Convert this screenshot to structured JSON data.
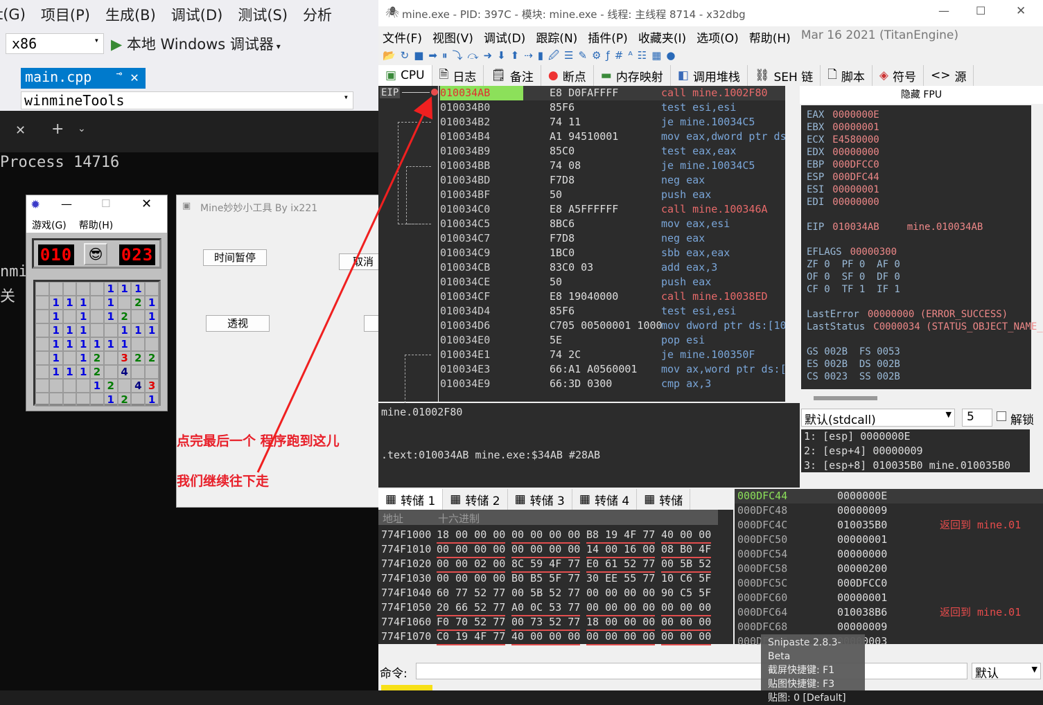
{
  "vs": {
    "menu": [
      "t(G)",
      "项目(P)",
      "生成(B)",
      "调试(D)",
      "测试(S)",
      "分析"
    ],
    "platform": "x86",
    "debugger_label": "本地 Windows 调试器",
    "tab_label": "main.cpp",
    "project_combo": "winmineTools"
  },
  "terminal": {
    "process_text": "Process 14716",
    "frag1": "nmi",
    "frag2": "关"
  },
  "minesweeper": {
    "menu": [
      "游戏(G)",
      "帮助(H)"
    ],
    "mine_counter": "010",
    "timer": "023",
    "grid": [
      [
        "",
        "",
        "",
        "",
        "",
        "1",
        "1",
        "1",
        ""
      ],
      [
        "",
        "1",
        "1",
        "1",
        "",
        "1",
        "",
        "2",
        "1"
      ],
      [
        "",
        "1",
        "",
        "1",
        "",
        "1",
        "2",
        "",
        "1"
      ],
      [
        "",
        "1",
        "1",
        "1",
        "",
        "",
        "1",
        "1",
        "1"
      ],
      [
        "",
        "1",
        "1",
        "1",
        "1",
        "1",
        "1",
        "",
        ""
      ],
      [
        "",
        "1",
        "",
        "1",
        "2",
        "",
        "3",
        "2",
        "2"
      ],
      [
        "",
        "1",
        "1",
        "1",
        "2",
        "",
        "4",
        "",
        ""
      ],
      [
        "",
        "",
        "",
        "",
        "1",
        "2",
        "",
        "4",
        "3"
      ],
      [
        "",
        "",
        "",
        "",
        "",
        "1",
        "2",
        "",
        "1"
      ]
    ]
  },
  "tool": {
    "title": "Mine妙妙小工具 By ix221",
    "btn_pause": "时间暂停",
    "btn_cancel": "取消",
    "btn_see": "透视",
    "note1": "点完最后一个  程序跑到这儿",
    "note2": "我们继续往下走"
  },
  "x32dbg": {
    "title": "mine.exe - PID: 397C - 模块: mine.exe - 线程: 主线程 8714 - x32dbg",
    "menu": [
      "文件(F)",
      "视图(V)",
      "调试(D)",
      "跟踪(N)",
      "插件(P)",
      "收藏夹(I)",
      "选项(O)",
      "帮助(H)",
      "Mar 16 2021 (TitanEngine)"
    ],
    "tabs": [
      "CPU",
      "日志",
      "备注",
      "断点",
      "内存映射",
      "调用堆栈",
      "SEH 链",
      "脚本",
      "符号",
      "源"
    ],
    "eip_label": "EIP",
    "disasm": [
      [
        "010034AB",
        "E8 D0FAFFFF",
        "call mine.1002F80",
        "call"
      ],
      [
        "010034B0",
        "85F6",
        "test esi,esi",
        ""
      ],
      [
        "010034B2",
        "74 11",
        "je mine.10034C5",
        ""
      ],
      [
        "010034B4",
        "A1 94510001",
        "mov eax,dword ptr ds:",
        ""
      ],
      [
        "010034B9",
        "85C0",
        "test eax,eax",
        ""
      ],
      [
        "010034BB",
        "74 08",
        "je mine.10034C5",
        ""
      ],
      [
        "010034BD",
        "F7D8",
        "neg eax",
        ""
      ],
      [
        "010034BF",
        "50",
        "push eax",
        ""
      ],
      [
        "010034C0",
        "E8 A5FFFFFF",
        "call mine.100346A",
        "call"
      ],
      [
        "010034C5",
        "8BC6",
        "mov eax,esi",
        ""
      ],
      [
        "010034C7",
        "F7D8",
        "neg eax",
        ""
      ],
      [
        "010034C9",
        "1BC0",
        "sbb eax,eax",
        ""
      ],
      [
        "010034CB",
        "83C0 03",
        "add eax,3",
        ""
      ],
      [
        "010034CE",
        "50",
        "push eax",
        ""
      ],
      [
        "010034CF",
        "E8 19040000",
        "call mine.10038ED",
        "call"
      ],
      [
        "010034D4",
        "85F6",
        "test esi,esi",
        ""
      ],
      [
        "010034D6",
        "C705 00500001 1000",
        "mov dword ptr ds:[10",
        ""
      ],
      [
        "010034E0",
        "5E",
        "pop esi",
        ""
      ],
      [
        "010034E1",
        "74 2C",
        "je mine.100350F",
        ""
      ],
      [
        "010034E3",
        "66:A1 A0560001",
        "mov ax,word ptr ds:[",
        ""
      ],
      [
        "010034E9",
        "66:3D 0300",
        "cmp ax,3",
        ""
      ]
    ],
    "regs_header": "隐藏 FPU",
    "regs": [
      [
        "EAX",
        "0000000E",
        ""
      ],
      [
        "EBX",
        "00000001",
        ""
      ],
      [
        "ECX",
        "E4580000",
        ""
      ],
      [
        "EDX",
        "00000000",
        ""
      ],
      [
        "EBP",
        "000DFCC0",
        ""
      ],
      [
        "ESP",
        "000DFC44",
        ""
      ],
      [
        "ESI",
        "00000001",
        ""
      ],
      [
        "EDI",
        "00000000",
        ""
      ],
      [
        "",
        "",
        " "
      ],
      [
        "EIP",
        "010034AB",
        "mine.010034AB"
      ],
      [
        "",
        "",
        ""
      ],
      [
        "EFLAGS",
        "00000300",
        ""
      ],
      [
        "ZF 0  PF 0  AF 0",
        "",
        ""
      ],
      [
        "OF 0  SF 0  DF 0",
        "",
        ""
      ],
      [
        "CF 0  TF 1  IF 1",
        "",
        ""
      ],
      [
        "",
        "",
        ""
      ],
      [
        "LastError",
        "00000000 (ERROR_SUCCESS)",
        ""
      ],
      [
        "LastStatus",
        "C0000034 (STATUS_OBJECT_NAME_",
        ""
      ],
      [
        "",
        "",
        ""
      ],
      [
        "GS 002B  FS 0053",
        "",
        ""
      ],
      [
        "ES 002B  DS 002B",
        "",
        ""
      ],
      [
        "CS 0023  SS 002B",
        "",
        ""
      ]
    ],
    "info_line1": "mine.01002F80",
    "info_line2": ".text:010034AB mine.exe:$34AB #28AB",
    "callconv": "默认(stdcall)",
    "argcount": "5",
    "unlock_label": "解锁",
    "args": [
      "1: [esp] 0000000E",
      "2: [esp+4] 00000009",
      "3: [esp+8] 010035B0 mine.010035B0"
    ],
    "dump_tabs": [
      "转储 1",
      "转储 2",
      "转储 3",
      "转储 4",
      "转储"
    ],
    "dump_headers": [
      "地址",
      "十六进制"
    ],
    "dump": [
      [
        "774F1000",
        "18 00 00 00",
        "00 00 00 00",
        "B8 19 4F 77",
        "40 00 00"
      ],
      [
        "774F1010",
        "00 00 00 00",
        "00 00 00 00",
        "14 00 16 00",
        "08 B0 4F"
      ],
      [
        "774F1020",
        "00 00 02 00",
        "8C 59 4F 77",
        "E0 61 52 77",
        "00 5B 52"
      ],
      [
        "774F1030",
        "00 00 00 00",
        "B0 B5 5F 77",
        "30 EE 55 77",
        "10 C6 5F"
      ],
      [
        "774F1040",
        "60 77 52 77",
        "00 5B 52 77",
        "00 00 00 00",
        "90 C5 5F"
      ],
      [
        "774F1050",
        "20 66 52 77",
        "A0 0C 53 77",
        "00 00 00 00",
        "00 00 00"
      ],
      [
        "774F1060",
        "F0 70 52 77",
        "00 73 52 77",
        "18 00 00 00",
        "00 00 00"
      ],
      [
        "774F1070",
        "C0 19 4F 77",
        "40 00 00 00",
        "00 00 00 00",
        "00 00 00"
      ]
    ],
    "stack": [
      [
        "000DFC44",
        "0000000E",
        ""
      ],
      [
        "000DFC48",
        "00000009",
        ""
      ],
      [
        "000DFC4C",
        "010035B0",
        "返回到 mine.01"
      ],
      [
        "000DFC50",
        "00000001",
        ""
      ],
      [
        "000DFC54",
        "00000000",
        ""
      ],
      [
        "000DFC58",
        "00000200",
        ""
      ],
      [
        "000DFC5C",
        "000DFCC0",
        ""
      ],
      [
        "000DFC60",
        "00000001",
        ""
      ],
      [
        "000DFC64",
        "010038B6",
        "返回到 mine.01"
      ],
      [
        "000DFC68",
        "00000009",
        ""
      ],
      [
        "000DFC6C",
        "00000003",
        ""
      ]
    ],
    "cmd_label": "命令:",
    "cmd_mode": "默认"
  },
  "snipaste": {
    "title": "Snipaste 2.8.3-Beta",
    "line1": "截屏快捷键: F1",
    "line2": "贴图快捷键: F3",
    "line3": "贴图: 0 [Default]"
  }
}
